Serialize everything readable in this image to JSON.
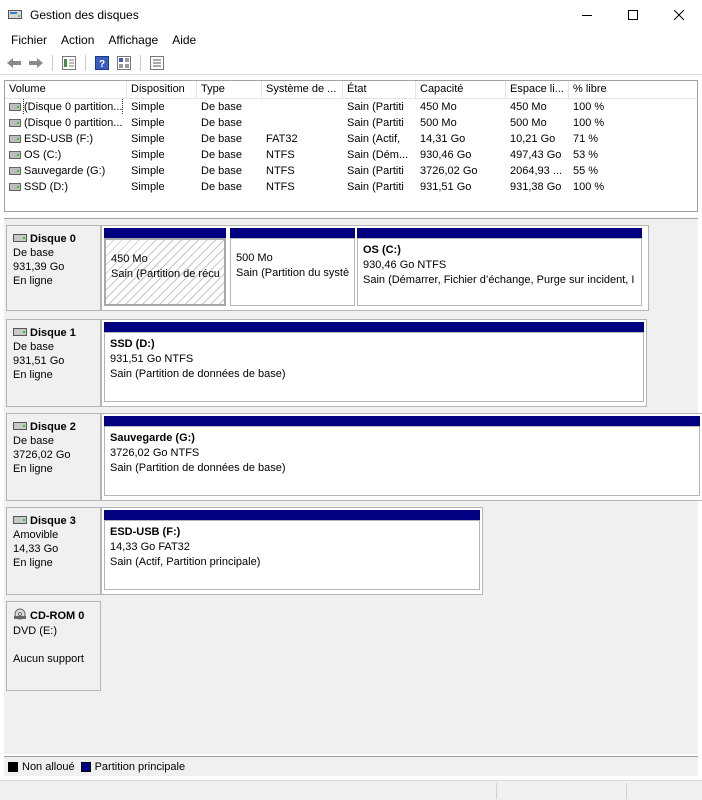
{
  "window": {
    "title": "Gestion des disques"
  },
  "menu": [
    "Fichier",
    "Action",
    "Affichage",
    "Aide"
  ],
  "toolbar": [
    {
      "icon": "back-arrow-icon"
    },
    {
      "icon": "forward-arrow-icon"
    },
    {
      "icon": "properties-icon"
    },
    {
      "icon": "help-icon"
    },
    {
      "icon": "grid-view-icon"
    },
    {
      "icon": "list-view-icon"
    }
  ],
  "volumes": {
    "columns": [
      "Volume",
      "Disposition",
      "Type",
      "Système de ...",
      "État",
      "Capacité",
      "Espace li...",
      "% libre"
    ],
    "rows": [
      [
        "(Disque 0 partition...",
        "Simple",
        "De base",
        "",
        "Sain (Partiti",
        "450 Mo",
        "450 Mo",
        "100 %"
      ],
      [
        "(Disque 0 partition...",
        "Simple",
        "De base",
        "",
        "Sain (Partiti",
        "500 Mo",
        "500 Mo",
        "100 %"
      ],
      [
        "ESD-USB (F:)",
        "Simple",
        "De base",
        "FAT32",
        "Sain (Actif,",
        "14,31 Go",
        "10,21 Go",
        "71 %"
      ],
      [
        "OS (C:)",
        "Simple",
        "De base",
        "NTFS",
        "Sain (Dém...",
        "930,46 Go",
        "497,43 Go",
        "53 %"
      ],
      [
        "Sauvegarde (G:)",
        "Simple",
        "De base",
        "NTFS",
        "Sain (Partiti",
        "3726,02 Go",
        "2064,93 ...",
        "55 %"
      ],
      [
        "SSD (D:)",
        "Simple",
        "De base",
        "NTFS",
        "Sain (Partiti",
        "931,51 Go",
        "931,38 Go",
        "100 %"
      ]
    ]
  },
  "disks": [
    {
      "name": "Disque 0",
      "type": "De base",
      "size": "931,39 Go",
      "status": "En ligne",
      "partitions": [
        {
          "name": "",
          "size": "450 Mo",
          "status": "Sain (Partition de récu",
          "selected": true
        },
        {
          "name": "",
          "size": "500 Mo",
          "status": "Sain (Partition du systè",
          "selected": false
        },
        {
          "name": "OS  (C:)",
          "size": "930,46 Go NTFS",
          "status": "Sain (Démarrer, Fichier d’échange, Purge sur incident, I",
          "selected": false
        }
      ]
    },
    {
      "name": "Disque 1",
      "type": "De base",
      "size": "931,51 Go",
      "status": "En ligne",
      "partitions": [
        {
          "name": "SSD  (D:)",
          "size": "931,51 Go NTFS",
          "status": "Sain (Partition de données de base)",
          "selected": false
        }
      ]
    },
    {
      "name": "Disque 2",
      "type": "De base",
      "size": "3726,02 Go",
      "status": "En ligne",
      "partitions": [
        {
          "name": "Sauvegarde  (G:)",
          "size": "3726,02 Go NTFS",
          "status": "Sain (Partition de données de base)",
          "selected": false
        }
      ]
    },
    {
      "name": "Disque 3",
      "type": "Amovible",
      "size": "14,33 Go",
      "status": "En ligne",
      "partitions": [
        {
          "name": "ESD-USB  (F:)",
          "size": "14,33 Go FAT32",
          "status": "Sain (Actif, Partition principale)",
          "selected": false
        }
      ]
    },
    {
      "name": "CD-ROM 0",
      "type": "DVD (E:)",
      "size": "",
      "status": "Aucun support",
      "partitions": []
    }
  ],
  "legend": [
    {
      "label": "Non alloué",
      "color": "#000000"
    },
    {
      "label": "Partition principale",
      "color": "#000080"
    }
  ],
  "colors": {
    "partition_bar": "#000080",
    "unallocated": "#000000",
    "panel_bg": "#f0f0f0"
  }
}
